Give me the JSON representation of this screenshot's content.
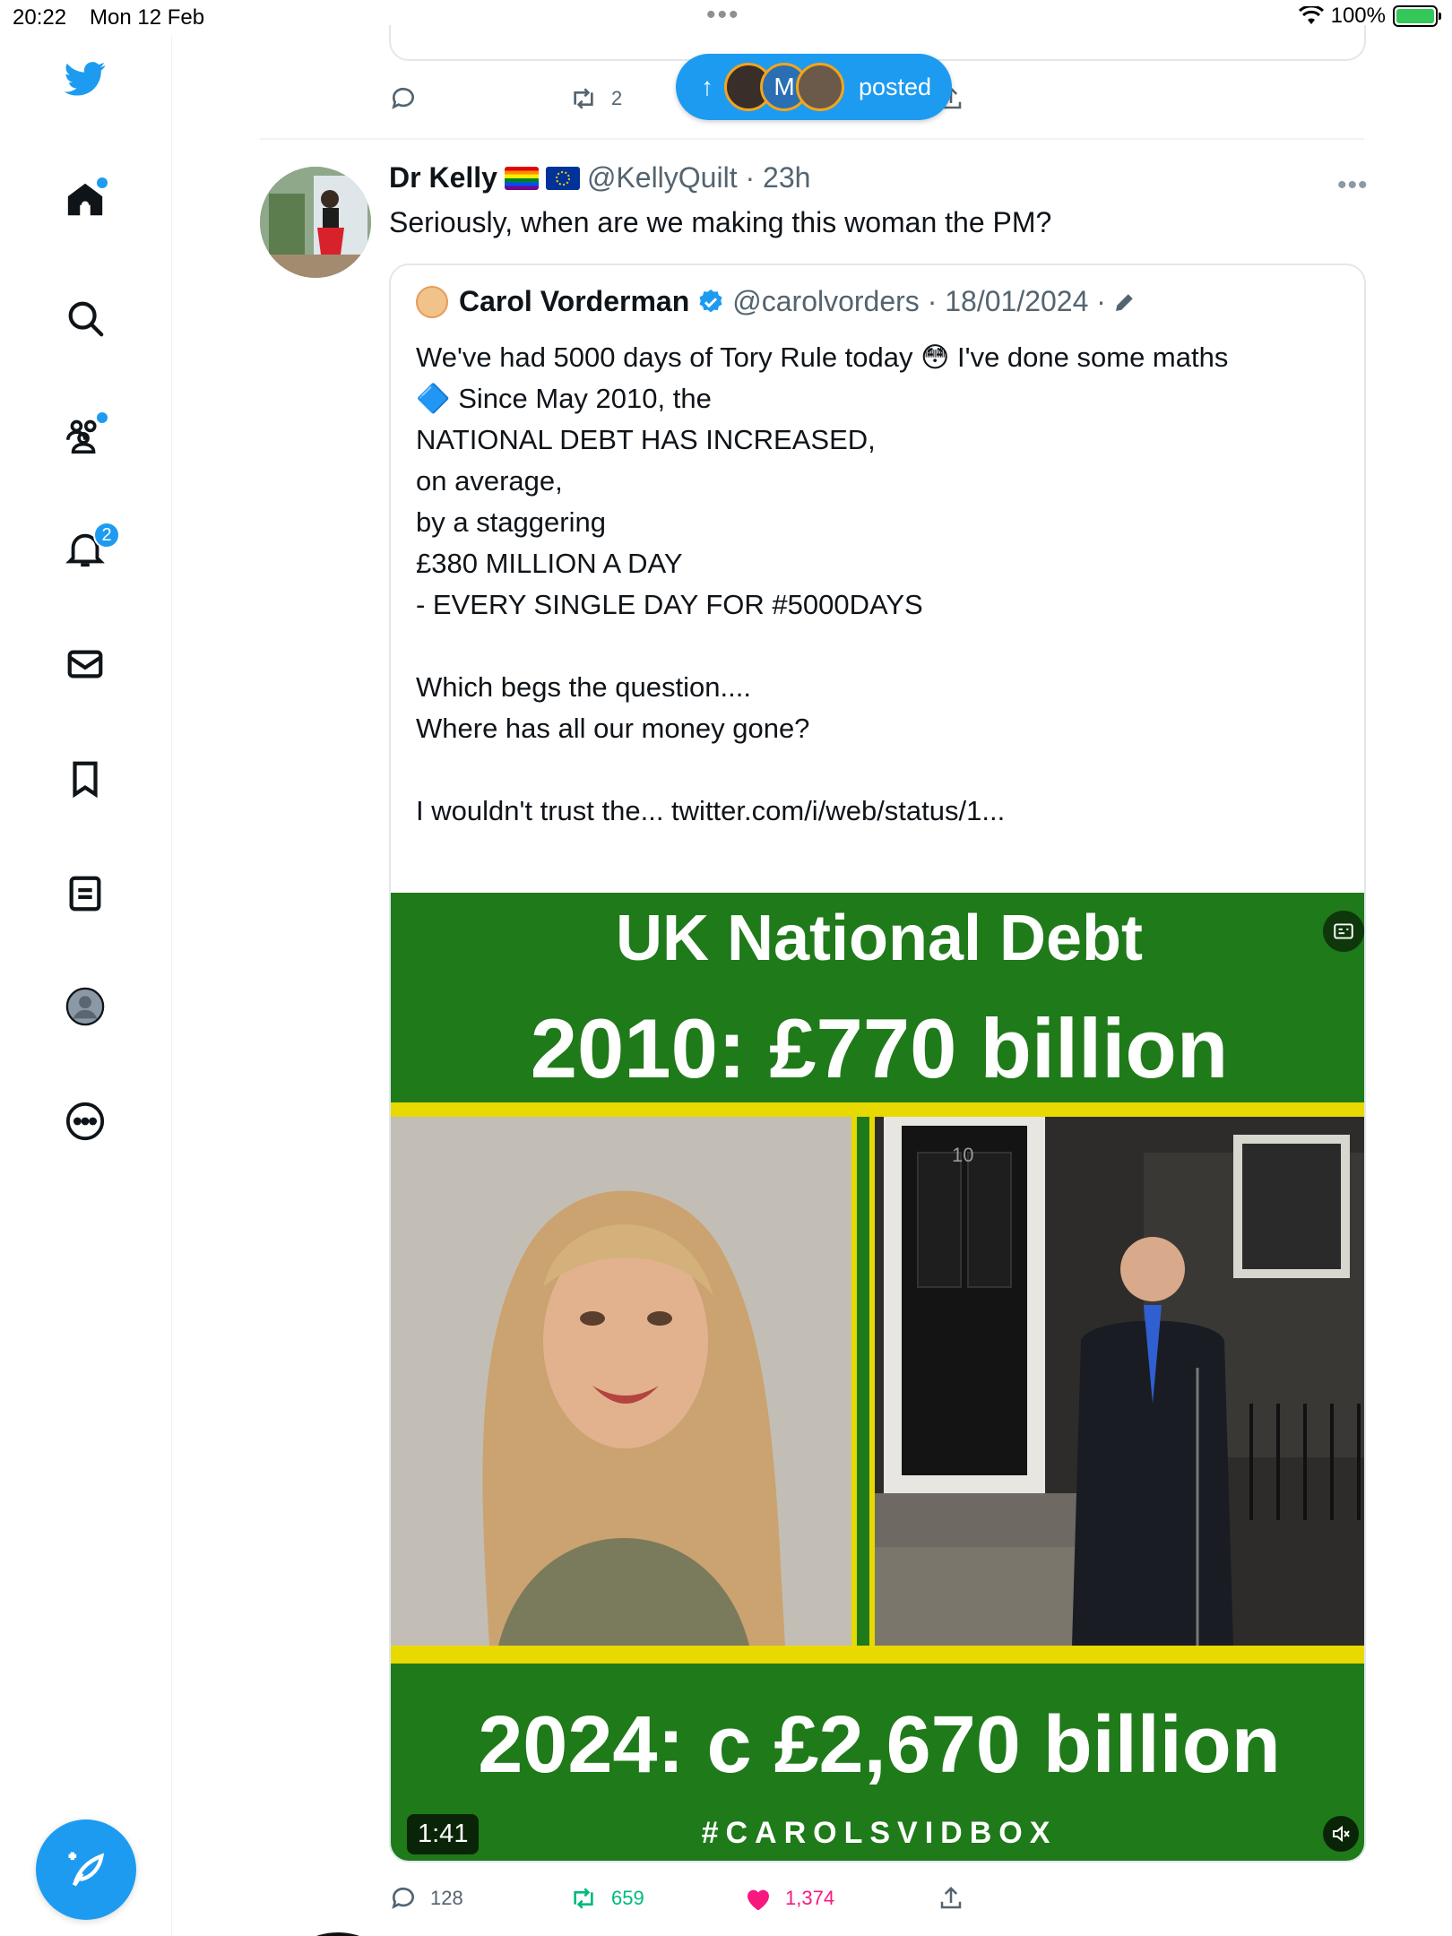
{
  "status_bar": {
    "time": "20:22",
    "date": "Mon 12 Feb",
    "battery": "100%"
  },
  "sidebar": {
    "logo": "twitter-bird-icon",
    "items": [
      {
        "name": "home",
        "icon": "home-icon",
        "badge_dot": true
      },
      {
        "name": "explore",
        "icon": "search-icon"
      },
      {
        "name": "communities",
        "icon": "communities-icon",
        "badge_dot": true
      },
      {
        "name": "notifications",
        "icon": "bell-icon",
        "badge": "2"
      },
      {
        "name": "messages",
        "icon": "mail-icon"
      },
      {
        "name": "bookmarks",
        "icon": "bookmark-icon"
      },
      {
        "name": "lists",
        "icon": "list-icon"
      },
      {
        "name": "profile",
        "icon": "profile-icon"
      },
      {
        "name": "more",
        "icon": "more-circle-icon"
      }
    ],
    "compose": "compose-icon"
  },
  "prev_tweet": {
    "retweets": "2"
  },
  "posted_pill": {
    "label": "posted",
    "avatar_initial": "M"
  },
  "tweet": {
    "name": "Dr Kelly",
    "handle_time": "@KellyQuilt · 23h",
    "text": "Seriously, when are we making this woman the PM?",
    "quote": {
      "name": "Carol Vorderman",
      "handle_date": "@carolvorders · 18/01/2024 ·",
      "lines": "We've had 5000 days of Tory Rule today 😳 I've done some maths\n🔷 Since May 2010, the\nNATIONAL DEBT HAS INCREASED,\non average,\nby a staggering\n£380 MILLION A DAY\n- EVERY SINGLE DAY FOR #5000DAYS\n\nWhich begs the question....\nWhere has all our money gone?\n\nI wouldn't trust the... twitter.com/i/web/status/1...",
      "media": {
        "title": "UK National Debt",
        "line_2010": "2010: £770 billion",
        "line_2024": "2024: c £2,670 billion",
        "hashtag": "#CAROLSVIDBOX",
        "duration": "1:41",
        "door_number": "10"
      }
    },
    "replies": "128",
    "retweets": "659",
    "likes": "1,374"
  },
  "colors": {
    "accent": "#1d9bf0",
    "retweet_green": "#00ba7c",
    "like_pink": "#f91880",
    "media_green": "#1f7a1a",
    "media_yellow": "#e8d900"
  }
}
